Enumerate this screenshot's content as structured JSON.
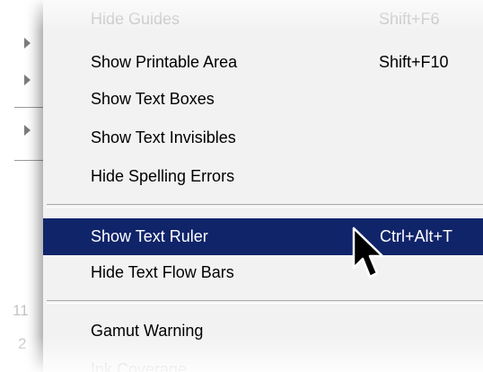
{
  "menu": {
    "items": [
      {
        "label": "Hide Guides",
        "shortcut": "Shift+F6"
      },
      {
        "label": "Show Printable Area",
        "shortcut": "Shift+F10"
      },
      {
        "label": "Show Text Boxes",
        "shortcut": ""
      },
      {
        "label": "Show Text Invisibles",
        "shortcut": ""
      },
      {
        "label": "Hide Spelling Errors",
        "shortcut": ""
      },
      {
        "label": "Show Text Ruler",
        "shortcut": "Ctrl+Alt+T"
      },
      {
        "label": "Hide Text Flow Bars",
        "shortcut": ""
      },
      {
        "label": "Gamut Warning",
        "shortcut": ""
      },
      {
        "label": "Ink Coverage",
        "shortcut": ""
      }
    ],
    "highlighted_item": "Show Text Ruler"
  },
  "background": {
    "numbers": [
      "11",
      "2"
    ]
  },
  "colors": {
    "highlight": "#10246a",
    "menu_bg": "#f2f2f2"
  },
  "icons": {
    "cursor": "mouse-pointer-icon",
    "submenu": "submenu-arrow-icon"
  }
}
